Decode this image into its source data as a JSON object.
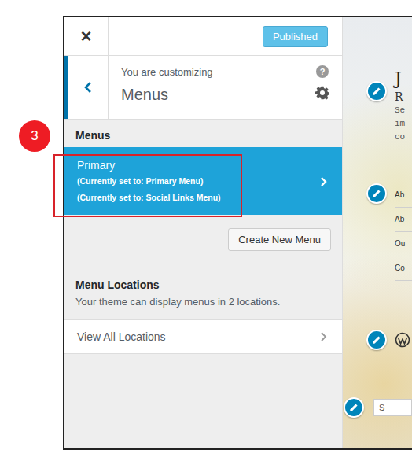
{
  "annotation": {
    "step": "3"
  },
  "header": {
    "close": "×",
    "publish_button": "Published"
  },
  "section": {
    "subtitle": "You are customizing",
    "title": "Menus",
    "help": "?"
  },
  "menus": {
    "heading": "Menus",
    "items": [
      {
        "name": "Primary",
        "locations": [
          "(Currently set to: Primary Menu)",
          "(Currently set to: Social Links Menu)"
        ],
        "selected": true
      }
    ],
    "create_button": "Create New Menu"
  },
  "locations": {
    "heading": "Menu Locations",
    "description": "Your theme can display menus in 2 locations.",
    "link": "View All Locations"
  },
  "preview": {
    "site_title": "J",
    "site_subtitle": "R",
    "description_lines": [
      "Se",
      "im",
      "co"
    ],
    "menu_items": [
      "Ab",
      "Ab",
      "Ou",
      "Co"
    ],
    "search_placeholder": "S"
  }
}
